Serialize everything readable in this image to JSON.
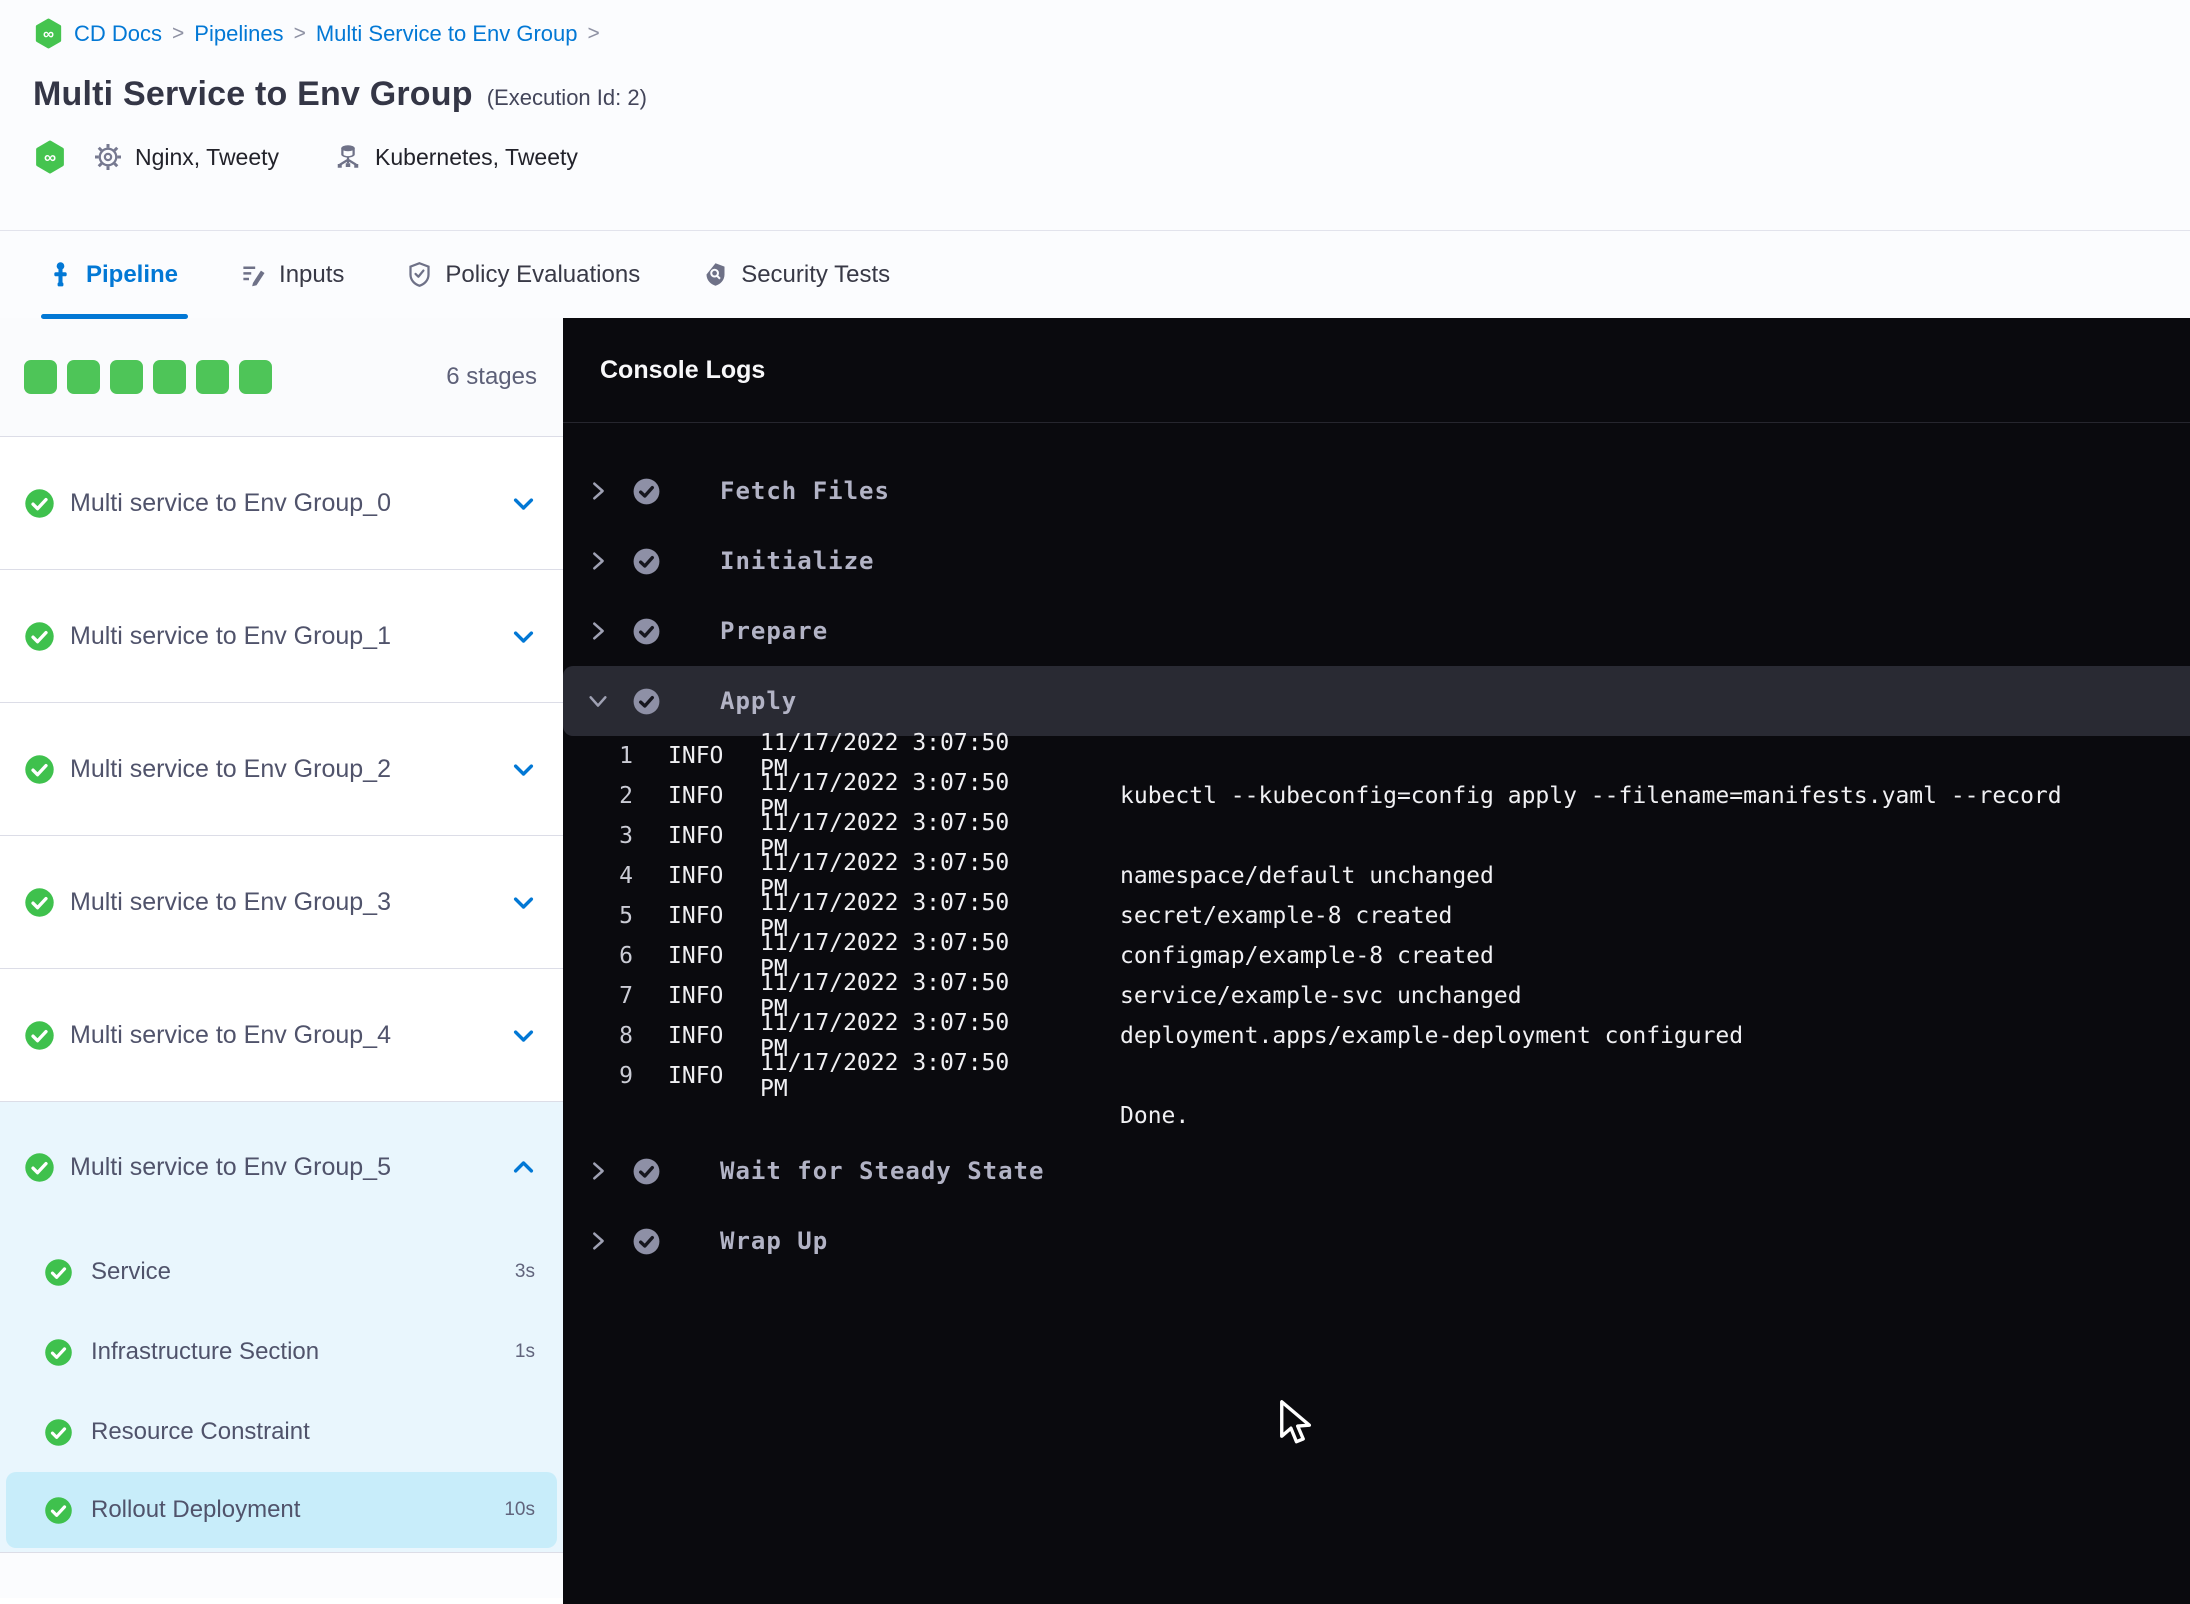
{
  "breadcrumb": {
    "separator": ">",
    "items": [
      "CD Docs",
      "Pipelines",
      "Multi Service to Env Group"
    ]
  },
  "header": {
    "title": "Multi Service to Env Group",
    "execution_id": "(Execution Id: 2)",
    "services_label": "Nginx, Tweety",
    "environments_label": "Kubernetes, Tweety"
  },
  "tabs": [
    {
      "label": "Pipeline",
      "active": true
    },
    {
      "label": "Inputs",
      "active": false
    },
    {
      "label": "Policy Evaluations",
      "active": false
    },
    {
      "label": "Security Tests",
      "active": false
    }
  ],
  "sidebar": {
    "stage_count_label": "6 stages",
    "completed_squares": 6,
    "stages": [
      {
        "label": "Multi service to Env Group_0",
        "status": "success",
        "expanded": false
      },
      {
        "label": "Multi service to Env Group_1",
        "status": "success",
        "expanded": false
      },
      {
        "label": "Multi service to Env Group_2",
        "status": "success",
        "expanded": false
      },
      {
        "label": "Multi service to Env Group_3",
        "status": "success",
        "expanded": false
      },
      {
        "label": "Multi service to Env Group_4",
        "status": "success",
        "expanded": false
      },
      {
        "label": "Multi service to Env Group_5",
        "status": "success",
        "expanded": true,
        "steps": [
          {
            "label": "Service",
            "duration": "3s",
            "selected": false
          },
          {
            "label": "Infrastructure Section",
            "duration": "1s",
            "selected": false
          },
          {
            "label": "Resource Constraint",
            "duration": "",
            "selected": false
          },
          {
            "label": "Rollout Deployment",
            "duration": "10s",
            "selected": true
          }
        ]
      }
    ]
  },
  "console": {
    "title": "Console Logs",
    "sections": [
      {
        "label": "Fetch Files",
        "expanded": false
      },
      {
        "label": "Initialize",
        "expanded": false
      },
      {
        "label": "Prepare",
        "expanded": false
      },
      {
        "label": "Apply",
        "expanded": true,
        "logs": [
          {
            "n": "1",
            "level": "INFO",
            "ts": "11/17/2022 3:07:50 PM",
            "msg": ""
          },
          {
            "n": "2",
            "level": "INFO",
            "ts": "11/17/2022 3:07:50 PM",
            "msg": "kubectl --kubeconfig=config apply --filename=manifests.yaml --record"
          },
          {
            "n": "3",
            "level": "INFO",
            "ts": "11/17/2022 3:07:50 PM",
            "msg": ""
          },
          {
            "n": "4",
            "level": "INFO",
            "ts": "11/17/2022 3:07:50 PM",
            "msg": "namespace/default unchanged"
          },
          {
            "n": "5",
            "level": "INFO",
            "ts": "11/17/2022 3:07:50 PM",
            "msg": "secret/example-8 created"
          },
          {
            "n": "6",
            "level": "INFO",
            "ts": "11/17/2022 3:07:50 PM",
            "msg": "configmap/example-8 created"
          },
          {
            "n": "7",
            "level": "INFO",
            "ts": "11/17/2022 3:07:50 PM",
            "msg": "service/example-svc unchanged"
          },
          {
            "n": "8",
            "level": "INFO",
            "ts": "11/17/2022 3:07:50 PM",
            "msg": "deployment.apps/example-deployment configured"
          },
          {
            "n": "9",
            "level": "INFO",
            "ts": "11/17/2022 3:07:50 PM",
            "msg": ""
          },
          {
            "n": "",
            "level": "",
            "ts": "",
            "msg": "Done."
          }
        ]
      },
      {
        "label": "Wait for Steady State",
        "expanded": false
      },
      {
        "label": "Wrap Up",
        "expanded": false
      }
    ]
  },
  "colors": {
    "accent_blue": "#0278d5",
    "success_green": "#4ec558",
    "console_bg": "#0a0a0e",
    "selected_row_bg": "#292a33",
    "expanded_stage_bg": "#e9f6fd",
    "selected_step_bg": "#c8edfa"
  }
}
